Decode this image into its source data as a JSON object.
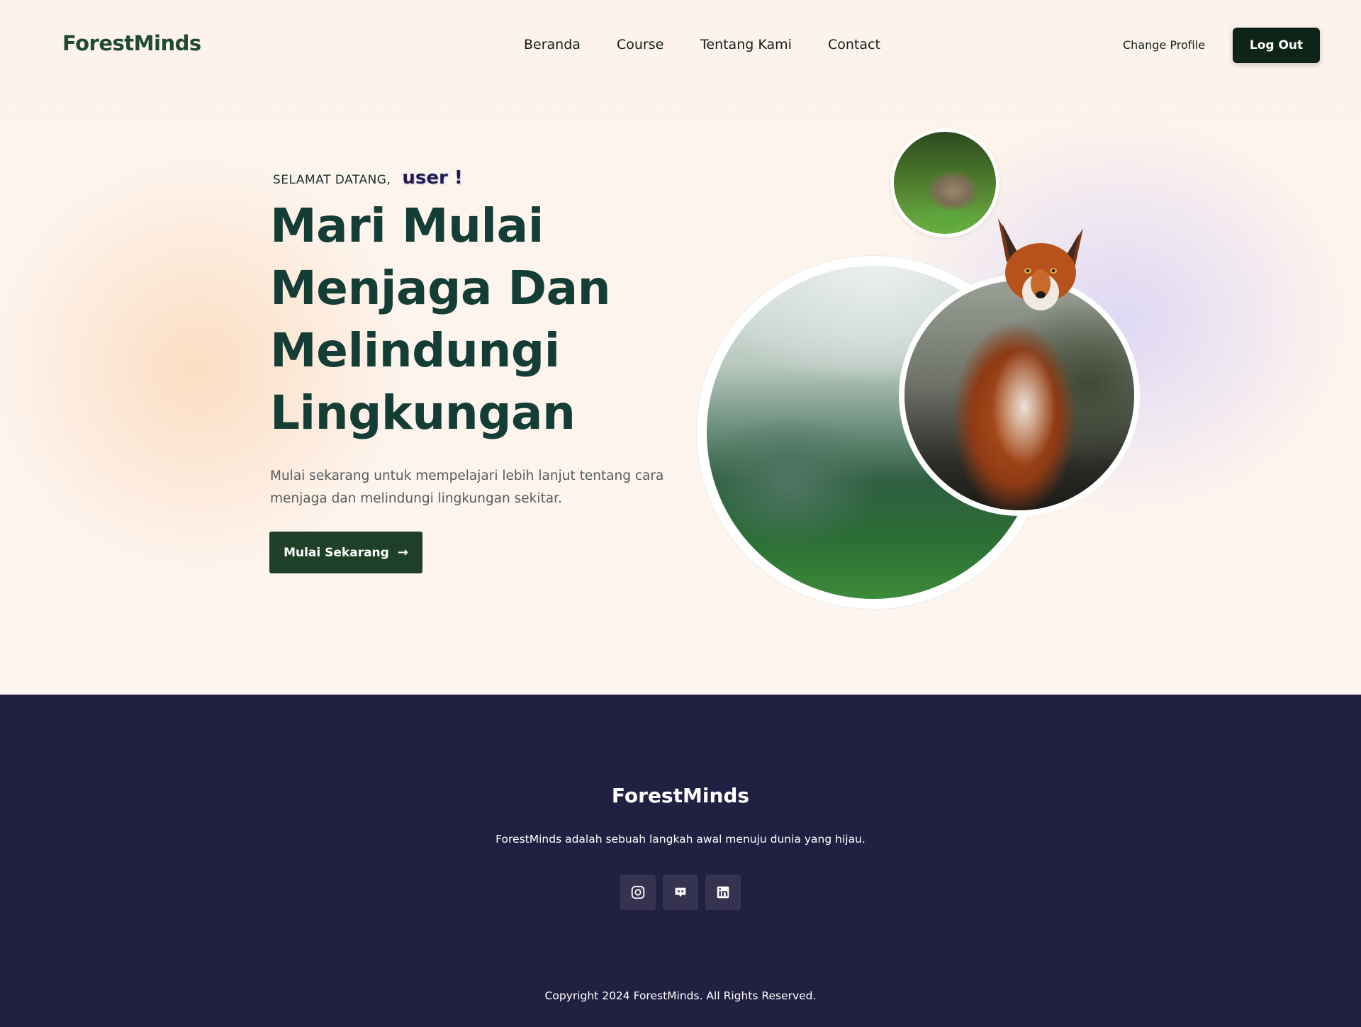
{
  "header": {
    "brand": "ForestMinds",
    "nav": [
      "Beranda",
      "Course",
      "Tentang Kami",
      "Contact"
    ],
    "change_profile": "Change Profile",
    "logout": "Log Out"
  },
  "hero": {
    "greeting_label": "SELAMAT DATANG,",
    "greeting_user": "user !",
    "title": "Mari Mulai Menjaga Dan Melindungi Lingkungan",
    "description": "Mulai sekarang untuk mempelajari lebih lanjut tentang cara menjaga dan melindungi lingkungan sekitar.",
    "cta_label": "Mulai Sekarang",
    "cta_icon": "arrow-right-icon",
    "images": [
      "rabbit-photo",
      "forest-photo",
      "fox-photo"
    ]
  },
  "footer": {
    "brand": "ForestMinds",
    "tagline": "ForestMinds adalah sebuah langkah awal menuju dunia yang hijau.",
    "socials": [
      "instagram-icon",
      "discord-icon",
      "linkedin-icon"
    ],
    "copyright": "Copyright 2024 ForestMinds. All Rights Reserved."
  },
  "colors": {
    "brand_green": "#1f4a31",
    "title_teal": "#143d36",
    "cta_green": "#1f4028",
    "logout_dark": "#0f2418",
    "footer_bg": "#222042",
    "social_bg": "#35334f"
  }
}
